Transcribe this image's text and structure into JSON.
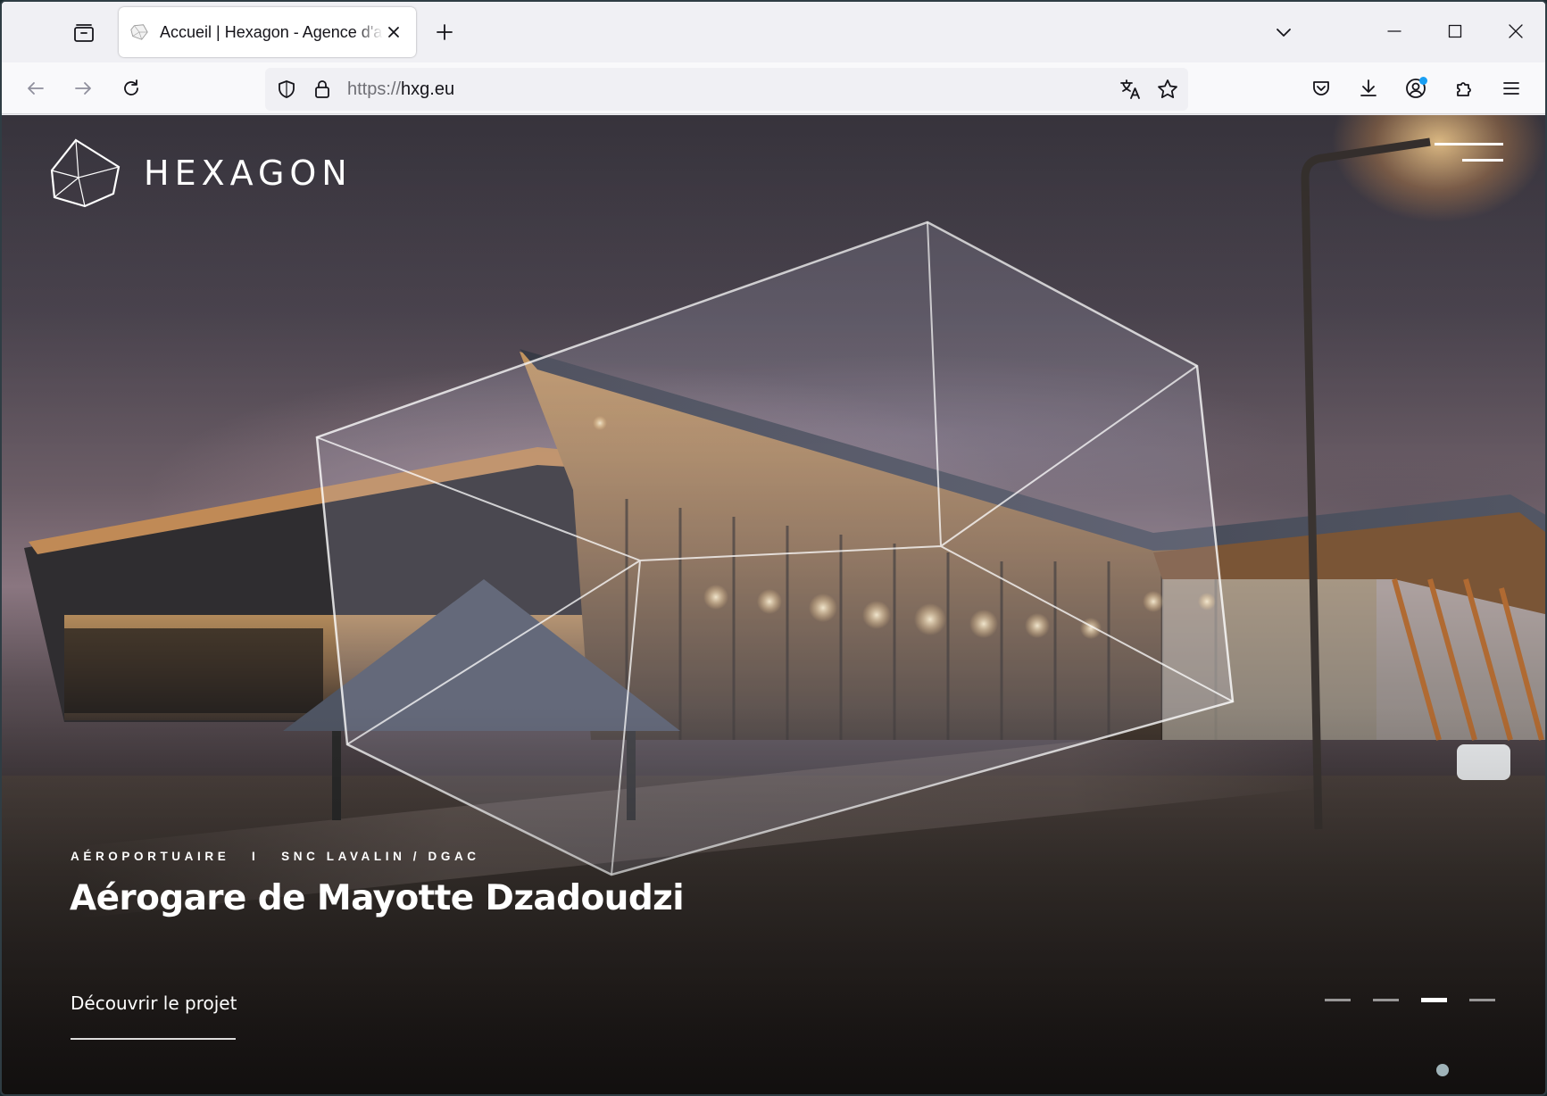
{
  "browser": {
    "tab": {
      "title": "Accueil | Hexagon - Agence d'architecture",
      "favicon": "hexagon-favicon"
    },
    "url": {
      "scheme": "https://",
      "host": "hxg.eu"
    },
    "icons": {
      "tab_list": "tab-list-icon",
      "new_tab": "plus-icon",
      "list_all_tabs": "chevron-down-icon",
      "minimize": "minimize-icon",
      "maximize": "maximize-icon",
      "close": "close-icon",
      "back": "arrow-left-icon",
      "forward": "arrow-right-icon",
      "reload": "reload-icon",
      "shield": "shield-icon",
      "lock": "lock-icon",
      "translate": "translate-icon",
      "bookmark": "star-icon",
      "pocket": "pocket-icon",
      "downloads": "download-icon",
      "account": "account-icon",
      "extensions": "puzzle-icon",
      "menu": "menu-icon"
    }
  },
  "site": {
    "logo": {
      "wordmark": "HEXAGON"
    },
    "menu_icon": "hamburger-icon",
    "hero": {
      "category": "AÉROPORTUAIRE",
      "separator": "I",
      "client": "SNC LAVALIN / DGAC",
      "title": "Aérogare de Mayotte Dzadoudzi",
      "cta": "Découvrir le projet"
    },
    "slider": {
      "count": 4,
      "active_index": 3
    },
    "colors": {
      "text": "#ffffff",
      "accent_dot": "#9fb3b8"
    }
  }
}
